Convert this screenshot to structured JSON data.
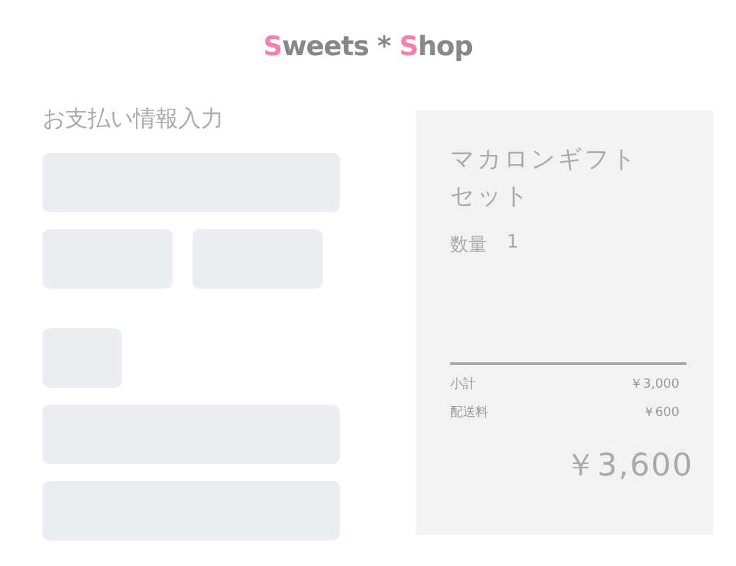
{
  "logo": [
    {
      "text": "S",
      "accent": true
    },
    {
      "text": "weets * ",
      "accent": false
    },
    {
      "text": "S",
      "accent": true
    },
    {
      "text": "hop",
      "accent": false
    }
  ],
  "form": {
    "title": "お支払い情報入力",
    "rows": [
      [
        {
          "kind": "full"
        }
      ],
      [
        {
          "kind": "half"
        },
        {
          "kind": "half"
        }
      ],
      [
        {
          "kind": "short"
        }
      ],
      [
        {
          "kind": "full"
        }
      ],
      [
        {
          "kind": "full"
        }
      ]
    ]
  },
  "summary": {
    "product": "マカロンギフトセット",
    "quantity_label": "数量",
    "quantity": "1",
    "lines": [
      {
        "label": "小計",
        "amount": "￥3,000"
      },
      {
        "label": "配送料",
        "amount": "￥600"
      }
    ],
    "total": "￥3,600"
  }
}
